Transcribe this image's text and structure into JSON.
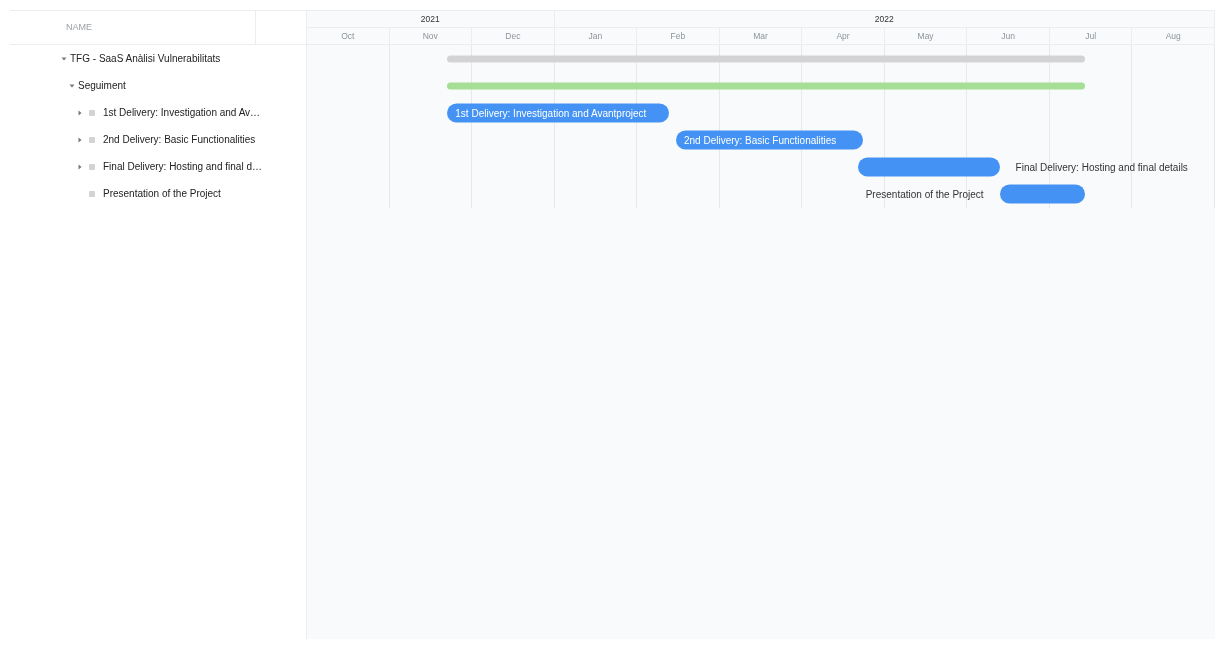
{
  "tree_header": {
    "name_column": "NAME"
  },
  "timeline": {
    "years": [
      {
        "label": "2021"
      },
      {
        "label": "2022"
      }
    ],
    "months": [
      {
        "label": "Oct"
      },
      {
        "label": "Nov"
      },
      {
        "label": "Dec"
      },
      {
        "label": "Jan"
      },
      {
        "label": "Feb"
      },
      {
        "label": "Mar"
      },
      {
        "label": "Apr"
      },
      {
        "label": "May"
      },
      {
        "label": "Jun"
      },
      {
        "label": "Jul"
      },
      {
        "label": "Aug"
      }
    ]
  },
  "tasks": [
    {
      "name": "TFG - SaaS Anàlisi Vulnerabilitats",
      "kind": "project",
      "expanded": true,
      "bar": {
        "color": "#d3d3d5"
      },
      "children": [
        {
          "name": "Seguiment",
          "kind": "project",
          "expanded": true,
          "bar": {
            "color": "#a5de95"
          },
          "children": [
            {
              "name": "1st Delivery: Investigation and Av…",
              "kind": "task",
              "expanded": false,
              "bar": {
                "color": "#4493f4",
                "label": "1st Delivery: Investigation and Avantproject",
                "kind": "inside"
              }
            },
            {
              "name": "2nd Delivery: Basic Functionalities",
              "kind": "task",
              "expanded": false,
              "bar": {
                "color": "#4493f4",
                "label": "2nd Delivery: Basic Functionalities",
                "kind": "inside"
              }
            },
            {
              "name": "Final Delivery: Hosting and final d…",
              "kind": "task",
              "expanded": false,
              "bar": {
                "color": "#4493f4",
                "label": "Final Delivery: Hosting and final details",
                "kind": "right"
              }
            },
            {
              "name": "Presentation of the Project",
              "kind": "task",
              "bar": {
                "color": "#4493f4",
                "label": "Presentation of the Project",
                "kind": "left"
              }
            }
          ]
        }
      ]
    }
  ]
}
